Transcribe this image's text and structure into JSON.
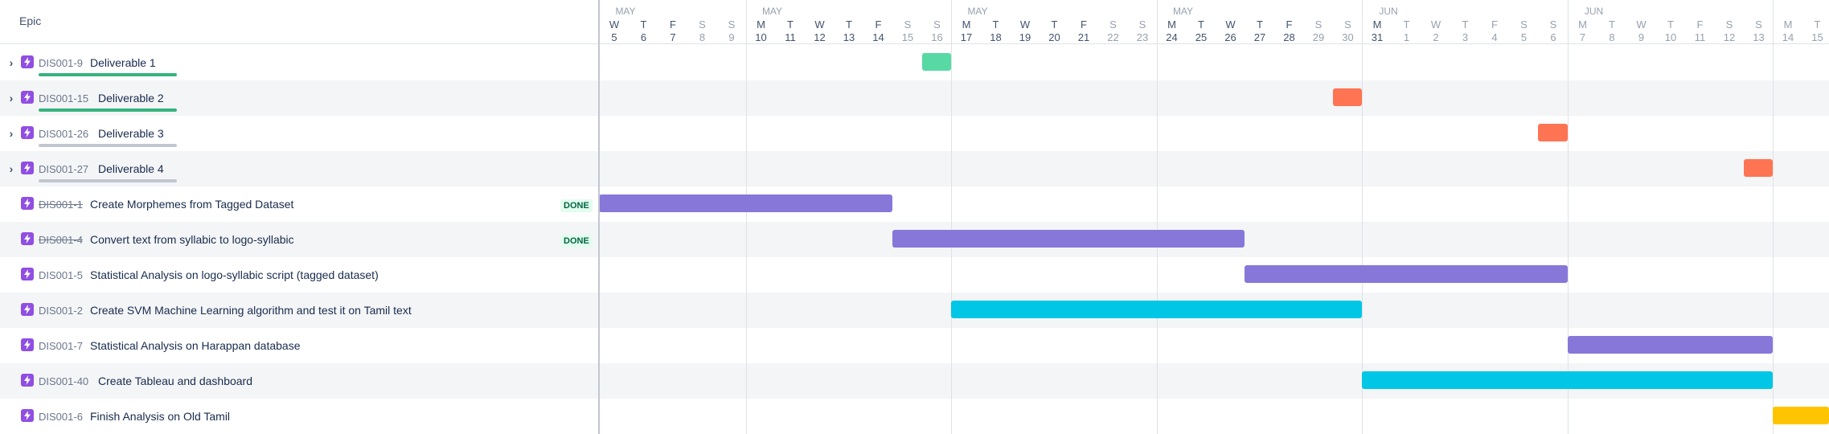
{
  "header": {
    "epic_column_label": "Epic"
  },
  "colors": {
    "epic_icon": "#904ee2",
    "progress_green": "#36b37e",
    "progress_grey": "#c1c7d0",
    "bar_green": "#57d9a3",
    "bar_orange": "#ff7452",
    "bar_purple": "#8777d9",
    "bar_cyan": "#00c7e6",
    "bar_yellow": "#ffc400",
    "weekday_text": "#42526e",
    "weekend_text": "#97a0af",
    "june_text": "#97a0af"
  },
  "timeline": {
    "start_date": "2021-05-05",
    "months": [
      {
        "label": "MAY",
        "anchor_day_index": 0
      },
      {
        "label": "MAY",
        "anchor_day_index": 5
      },
      {
        "label": "MAY",
        "anchor_day_index": 12
      },
      {
        "label": "MAY",
        "anchor_day_index": 19
      },
      {
        "label": "JUN",
        "anchor_day_index": 26
      },
      {
        "label": "JUN",
        "anchor_day_index": 33
      }
    ],
    "days": [
      {
        "letter": "W",
        "num": "5"
      },
      {
        "letter": "T",
        "num": "6"
      },
      {
        "letter": "F",
        "num": "7"
      },
      {
        "letter": "S",
        "num": "8"
      },
      {
        "letter": "S",
        "num": "9"
      },
      {
        "letter": "M",
        "num": "10"
      },
      {
        "letter": "T",
        "num": "11"
      },
      {
        "letter": "W",
        "num": "12"
      },
      {
        "letter": "T",
        "num": "13"
      },
      {
        "letter": "F",
        "num": "14"
      },
      {
        "letter": "S",
        "num": "15"
      },
      {
        "letter": "S",
        "num": "16"
      },
      {
        "letter": "M",
        "num": "17"
      },
      {
        "letter": "T",
        "num": "18"
      },
      {
        "letter": "W",
        "num": "19"
      },
      {
        "letter": "T",
        "num": "20"
      },
      {
        "letter": "F",
        "num": "21"
      },
      {
        "letter": "S",
        "num": "22"
      },
      {
        "letter": "S",
        "num": "23"
      },
      {
        "letter": "M",
        "num": "24"
      },
      {
        "letter": "T",
        "num": "25"
      },
      {
        "letter": "W",
        "num": "26"
      },
      {
        "letter": "T",
        "num": "27"
      },
      {
        "letter": "F",
        "num": "28"
      },
      {
        "letter": "S",
        "num": "29"
      },
      {
        "letter": "S",
        "num": "30"
      },
      {
        "letter": "M",
        "num": "31"
      },
      {
        "letter": "T",
        "num": "1"
      },
      {
        "letter": "W",
        "num": "2"
      },
      {
        "letter": "T",
        "num": "3"
      },
      {
        "letter": "F",
        "num": "4"
      },
      {
        "letter": "S",
        "num": "5"
      },
      {
        "letter": "S",
        "num": "6"
      },
      {
        "letter": "M",
        "num": "7"
      },
      {
        "letter": "T",
        "num": "8"
      },
      {
        "letter": "W",
        "num": "9"
      },
      {
        "letter": "T",
        "num": "10"
      },
      {
        "letter": "F",
        "num": "11"
      },
      {
        "letter": "S",
        "num": "12"
      },
      {
        "letter": "S",
        "num": "13"
      },
      {
        "letter": "M",
        "num": "14"
      },
      {
        "letter": "T",
        "num": "15"
      }
    ]
  },
  "rows": [
    {
      "key": "DIS001-9",
      "summary": "Deliverable 1",
      "expandable": true,
      "done": false,
      "progress": "green",
      "bar_color": "bar_green",
      "start": "2021-05-16",
      "end": "2021-05-16"
    },
    {
      "key": "DIS001-15",
      "summary": "Deliverable 2",
      "expandable": true,
      "done": false,
      "progress": "green",
      "bar_color": "bar_orange",
      "start": "2021-05-30",
      "end": "2021-05-30"
    },
    {
      "key": "DIS001-26",
      "summary": "Deliverable 3",
      "expandable": true,
      "done": false,
      "progress": "grey",
      "bar_color": "bar_orange",
      "start": "2021-06-06",
      "end": "2021-06-06"
    },
    {
      "key": "DIS001-27",
      "summary": "Deliverable 4",
      "expandable": true,
      "done": false,
      "progress": "grey",
      "bar_color": "bar_orange",
      "start": "2021-06-13",
      "end": "2021-06-13"
    },
    {
      "key": "DIS001-1",
      "summary": "Create Morphemes from Tagged Dataset",
      "expandable": false,
      "done": true,
      "status": "DONE",
      "bar_color": "bar_purple",
      "start": "2021-05-05",
      "end": "2021-05-14"
    },
    {
      "key": "DIS001-4",
      "summary": "Convert text from syllabic to logo-syllabic",
      "expandable": false,
      "done": true,
      "status": "DONE",
      "bar_color": "bar_purple",
      "start": "2021-05-15",
      "end": "2021-05-26"
    },
    {
      "key": "DIS001-5",
      "summary": "Statistical Analysis on logo-syllabic script (tagged dataset)",
      "expandable": false,
      "done": false,
      "bar_color": "bar_purple",
      "start": "2021-05-27",
      "end": "2021-06-06"
    },
    {
      "key": "DIS001-2",
      "summary": "Create SVM Machine Learning algorithm and test it on Tamil text",
      "expandable": false,
      "done": false,
      "bar_color": "bar_cyan",
      "start": "2021-05-17",
      "end": "2021-05-30"
    },
    {
      "key": "DIS001-7",
      "summary": "Statistical Analysis on Harappan database",
      "expandable": false,
      "done": false,
      "bar_color": "bar_purple",
      "start": "2021-06-07",
      "end": "2021-06-13"
    },
    {
      "key": "DIS001-40",
      "summary": "Create Tableau and dashboard",
      "expandable": false,
      "done": false,
      "bar_color": "bar_cyan",
      "start": "2021-05-31",
      "end": "2021-06-13"
    },
    {
      "key": "DIS001-6",
      "summary": "Finish Analysis on Old Tamil",
      "expandable": false,
      "done": false,
      "bar_color": "bar_yellow",
      "start": "2021-06-14",
      "end": "2021-06-15"
    }
  ]
}
